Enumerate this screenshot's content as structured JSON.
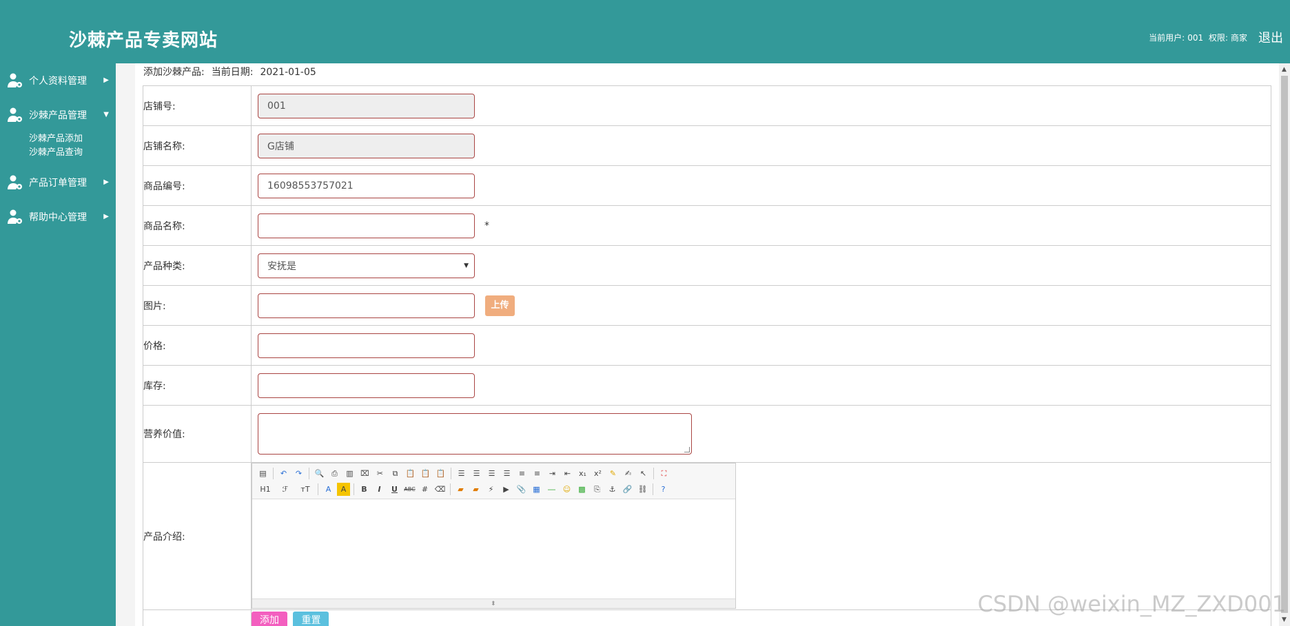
{
  "header": {
    "site_title": "沙棘产品专卖网站",
    "current_user_label": "当前用户:",
    "current_user": "001",
    "role_label": "权限:",
    "role": "商家",
    "logout": "退出"
  },
  "sidebar": {
    "items": [
      {
        "label": "个人资料管理",
        "arrow": "▶"
      },
      {
        "label": "沙棘产品管理",
        "arrow": "▼",
        "children": [
          "沙棘产品添加",
          "沙棘产品查询"
        ]
      },
      {
        "label": "产品订单管理",
        "arrow": "▶"
      },
      {
        "label": "帮助中心管理",
        "arrow": "▶"
      }
    ]
  },
  "breadcrumb": {
    "title": "添加沙棘产品:",
    "date_label": "当前日期:",
    "date": "2021-01-05"
  },
  "form": {
    "shop_no": {
      "label": "店铺号:",
      "value": "001"
    },
    "shop_name": {
      "label": "店铺名称:",
      "value": "G店铺"
    },
    "product_no": {
      "label": "商品编号:",
      "value": "16098553757021"
    },
    "product_name": {
      "label": "商品名称:",
      "value": "",
      "required_mark": "*"
    },
    "category": {
      "label": "产品种类:",
      "value": "安抚是"
    },
    "image": {
      "label": "图片:",
      "value": "",
      "upload_label": "上传"
    },
    "price": {
      "label": "价格:",
      "value": ""
    },
    "stock": {
      "label": "库存:",
      "value": ""
    },
    "nutrition": {
      "label": "营养价值:",
      "value": ""
    },
    "intro": {
      "label": "产品介绍:"
    }
  },
  "editor": {
    "row2_heading": "H1",
    "row2_font": "ℱ",
    "row2_size": "тT"
  },
  "actions": {
    "add": "添加",
    "reset": "重置"
  },
  "watermark": "CSDN @weixin_MZ_ZXD001",
  "colors": {
    "theme": "#339999",
    "input_border": "#a94442",
    "upload_button": "#f0ad7e",
    "add_button": "#f35fbf",
    "reset_button": "#5bc0de"
  }
}
